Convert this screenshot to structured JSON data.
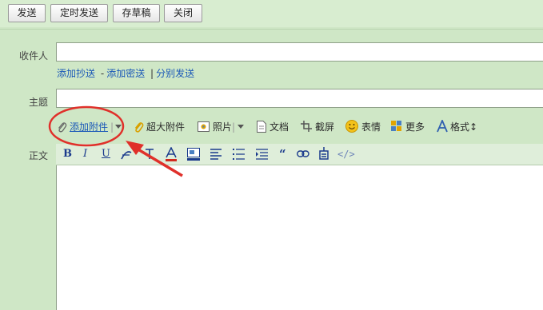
{
  "toolbar": {
    "send": "发送",
    "scheduled_send": "定时发送",
    "save_draft": "存草稿",
    "close": "关闭"
  },
  "compose": {
    "to_label": "收件人",
    "to_value": "",
    "cc_links": {
      "add_cc": "添加抄送",
      "dash": "-",
      "add_bcc": "添加密送",
      "pipe": "|",
      "separate_send": "分别发送"
    },
    "subject_label": "主题",
    "subject_value": "",
    "body_label": "正文",
    "body_value": ""
  },
  "attach_toolbar": {
    "add_attachment": "添加附件",
    "huge_attachment": "超大附件",
    "photo": "照片",
    "document": "文档",
    "screenshot": "截屏",
    "emoji": "表情",
    "more": "更多",
    "format": "格式"
  },
  "format_toolbar": {
    "bold": "B",
    "italic": "I",
    "underline": "U",
    "quote": "“",
    "source": "</>"
  },
  "icons": [
    "paperclip-icon",
    "dropdown-icon",
    "photo-icon",
    "document-icon",
    "screenshot-icon",
    "emoji-icon",
    "more-icon",
    "format-icon",
    "font-family-icon",
    "font-size-icon",
    "font-color-icon",
    "background-color-icon",
    "align-icon",
    "list-icon",
    "indent-icon",
    "link-icon",
    "special-icon"
  ],
  "colors": {
    "page_bg": "#cfe7c6",
    "link": "#1a58b8",
    "annotation": "#e0302a"
  }
}
